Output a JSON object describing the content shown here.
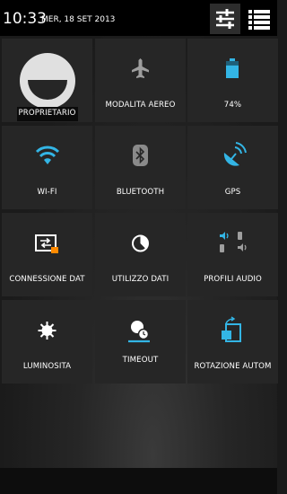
{
  "status_bar": {
    "time": "10:33",
    "date": "MER, 18 SET 2013",
    "buttons": [
      {
        "icon": "settings-sliders-icon",
        "selected": true
      },
      {
        "icon": "notification-list-icon",
        "selected": false
      }
    ]
  },
  "tiles": [
    {
      "id": "profile",
      "label": "PROPRIETARIO",
      "icon": "user-avatar-icon"
    },
    {
      "id": "airplane",
      "label": "MODALITÀ AEREO",
      "icon": "airplane-icon"
    },
    {
      "id": "battery",
      "label": "74%",
      "icon": "battery-icon",
      "battery_level": 0.74
    },
    {
      "id": "wifi",
      "label": "WI-FI",
      "icon": "wifi-icon"
    },
    {
      "id": "bluetooth",
      "label": "BLUETOOTH",
      "icon": "bluetooth-icon"
    },
    {
      "id": "gps",
      "label": "GPS",
      "icon": "gps-satellite-icon"
    },
    {
      "id": "data-connection",
      "label": "CONNESSIONE DAT",
      "icon": "data-connection-icon"
    },
    {
      "id": "data-usage",
      "label": "UTILIZZO DATI",
      "icon": "data-usage-pie-icon"
    },
    {
      "id": "audio-profiles",
      "label": "PROFILI AUDIO",
      "icon": "audio-profiles-icon"
    },
    {
      "id": "brightness",
      "label": "LUMINOSITÀ",
      "icon": "sun-brightness-icon"
    },
    {
      "id": "timeout",
      "label": "TIMEOUT",
      "icon": "timeout-clock-icon"
    },
    {
      "id": "rotation",
      "label": "ROTAZIONE AUTOM",
      "icon": "auto-rotate-icon"
    }
  ],
  "colors": {
    "accent": "#33b5e5",
    "icon_gray": "#bdbdbd",
    "tile_bg": "#262626",
    "status_bar_bg": "#000000",
    "avatar": "#e0e0e0"
  }
}
